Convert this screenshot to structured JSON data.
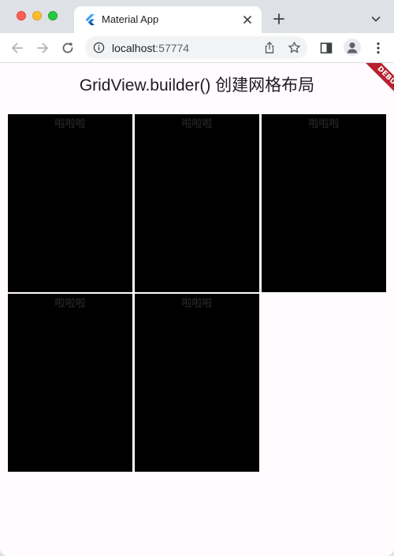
{
  "browser": {
    "tab": {
      "title": "Material App",
      "favicon": "flutter-icon"
    },
    "new_tab_icon": "plus-icon",
    "tab_search_icon": "chevron-down-icon",
    "toolbar": {
      "back_icon": "arrow-left-icon",
      "forward_icon": "arrow-right-icon",
      "reload_icon": "reload-icon",
      "sidepanel_icon": "side-panel-icon",
      "profile_icon": "person-icon",
      "menu_icon": "more-vertical-icon"
    },
    "omnibox": {
      "info_icon": "info-icon",
      "host": "localhost",
      "port": ":57774",
      "share_icon": "share-icon",
      "bookmark_icon": "star-icon"
    }
  },
  "app": {
    "title": "GridView.builder() 创建网格布局",
    "debug_banner": "DEBUG",
    "grid": {
      "columns": 3,
      "items": [
        {
          "label": "啦啦啦"
        },
        {
          "label": "啦啦啦"
        },
        {
          "label": "啦啦啦"
        },
        {
          "label": "啦啦啦"
        },
        {
          "label": "啦啦啦"
        }
      ]
    }
  },
  "colors": {
    "page_background": "#fffbfe",
    "cell_background": "#000000",
    "debug_ribbon": "#b7222f",
    "chrome_frame": "#dee1e6"
  }
}
